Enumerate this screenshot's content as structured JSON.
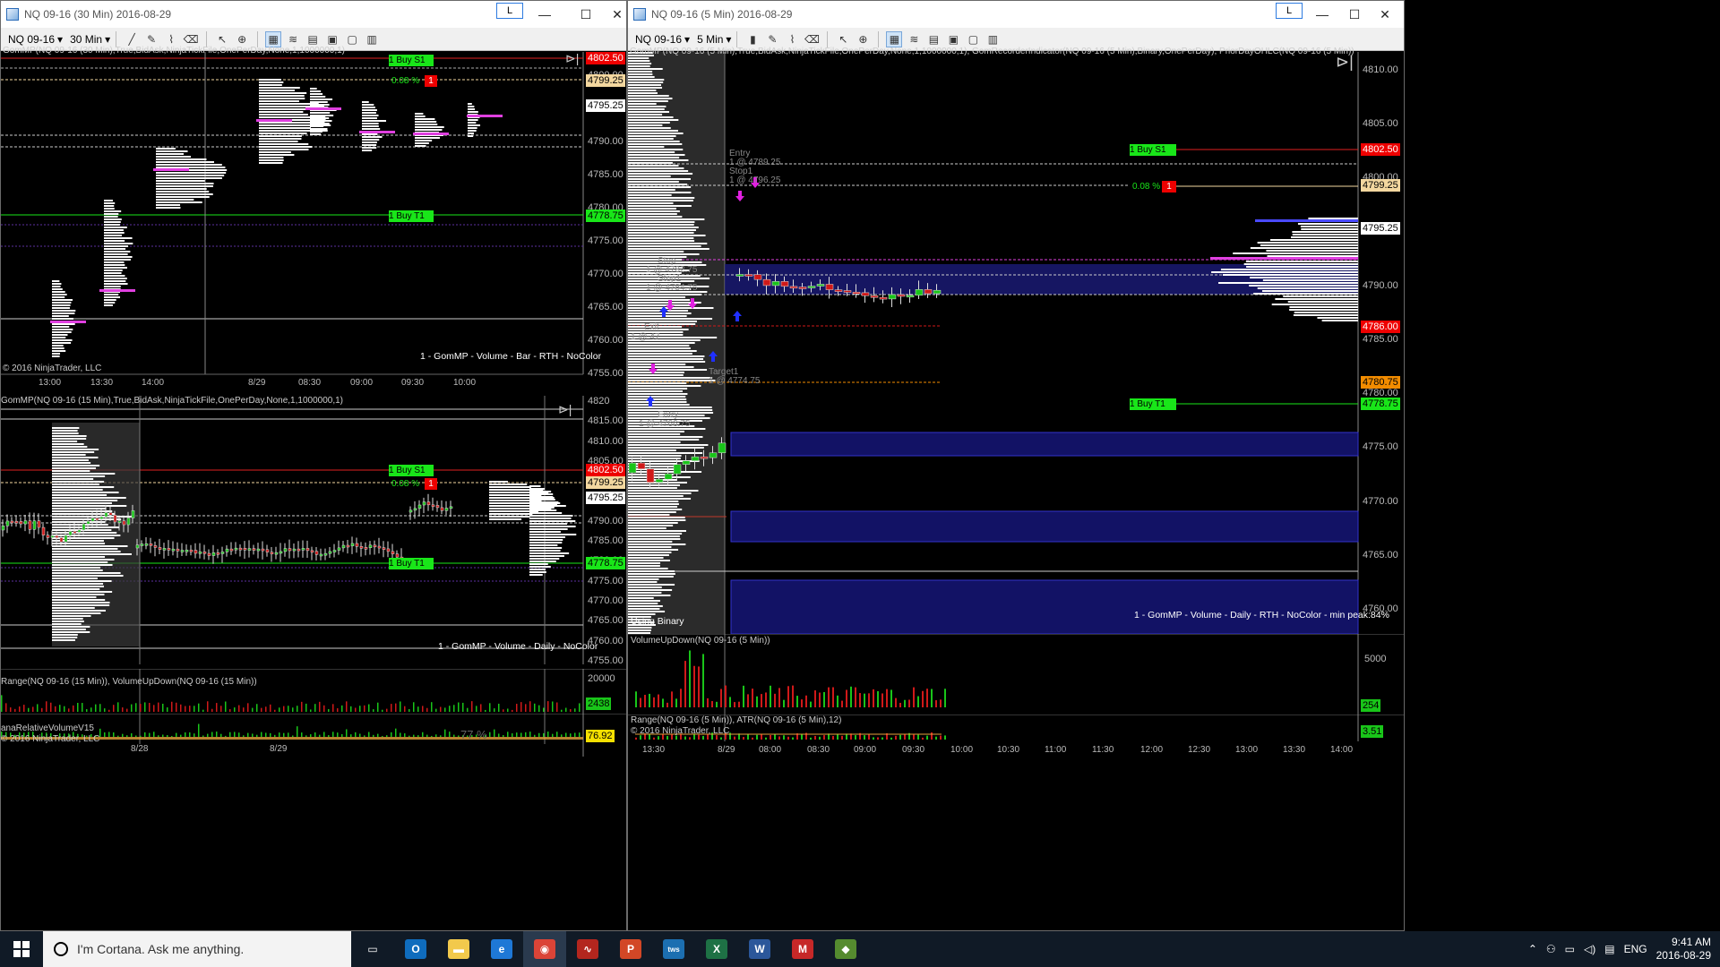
{
  "window_left": {
    "title": "NQ 09-16 (30 Min)  2016-08-29",
    "l_label": "L",
    "instrument": "NQ 09-16",
    "interval": "30 Min",
    "top_panel": {
      "indicator": "GomMP(NQ 09-16 (30 Min),True,BidAsk,NinjaTickFile,OnePerDay,None,1,1000000,1)",
      "copyright": "© 2016 NinjaTrader, LLC",
      "footer": "1 - GomMP  - Volume - Bar - RTH - NoColor",
      "price_ticks": [
        "4800.00",
        "4795.00",
        "4790.00",
        "4785.00",
        "4780.00",
        "4775.00",
        "4770.00",
        "4765.00",
        "4760.00",
        "4755.00"
      ],
      "time_ticks": [
        "13:00",
        "13:30",
        "14:00",
        "8/29",
        "08:30",
        "09:00",
        "09:30",
        "10:00"
      ],
      "tag_stop": "4802.50",
      "tag_pdc": "4799.25",
      "tag_last": "4795.25",
      "tag_target": "4778.75",
      "buy_s1": "1   Buy S1",
      "buy_t1": "1   Buy T1",
      "pct": "0.08 %",
      "pct_qty": "1"
    },
    "mid_panel": {
      "indicator": "GomMP(NQ 09-16 (15 Min),True,BidAsk,NinjaTickFile,OnePerDay,None,1,1000000,1)",
      "footer": "1 - GomMP  - Volume - Daily - NoColor",
      "price_ticks": [
        "4820",
        "4815.00",
        "4810.00",
        "4805.00",
        "4800.00",
        "4795.00",
        "4790.00",
        "4785.00",
        "4780.00",
        "4775.00",
        "4770.00",
        "4765.00",
        "4760.00",
        "4755.00"
      ],
      "tag_stop": "4802.50",
      "tag_pdc": "4799.25",
      "tag_last": "4795.25",
      "tag_target": "4778.75",
      "buy_s1": "1   Buy S1",
      "buy_t1": "1   Buy T1",
      "pct": "0.08 %",
      "pct_qty": "1"
    },
    "range_panel": {
      "indicator": "Range(NQ 09-16 (15 Min)), VolumeUpDown(NQ 09-16 (15 Min))",
      "tick": "20000",
      "tag": "2438"
    },
    "rel_panel": {
      "indicator": "anaRelativeVolumeV15",
      "copyright": "© 2016 NinjaTrader, LLC",
      "percent": "77 %",
      "tag": "76.92",
      "time_ticks": [
        "8/28",
        "8/29"
      ]
    }
  },
  "window_right": {
    "title": "NQ 09-16 (5 Min)  2016-08-29",
    "l_label": "L",
    "instrument": "NQ 09-16",
    "interval": "5 Min",
    "main_panel": {
      "indicator": "GomMP(NQ 09-16 (5 Min),True,BidAsk,NinjaTickFile,OnePerDay,None,1,1000000,1), GomRecorderIndicator(NQ 09-16 (5 Min),Binary,OnePerDay), PriorDayOHLC(NQ 09-16 (5 Min))",
      "using_binary": "Using Binary",
      "footer": "1 - GomMP  - Volume - Daily - RTH - NoColor - min peak:84%",
      "price_ticks": [
        "4810.00",
        "4805.00",
        "4800.00",
        "4795.00",
        "4790.00",
        "4785.00",
        "4780.00",
        "4775.00",
        "4770.00",
        "4765.00",
        "4760.00"
      ],
      "tag_stop": "4802.50",
      "tag_pdc": "4799.25",
      "tag_last": "4795.25",
      "tag_low": "4786.00",
      "tag_r1": "4780.75",
      "tag_target": "4778.75",
      "buy_s1": "1   Buy S1",
      "buy_t1": "1   Buy T1",
      "pct": "0.08 %",
      "pct_qty": "1",
      "trade_labels": [
        {
          "t": "Entry"
        },
        {
          "t": "1 @ 4789.25"
        },
        {
          "t": "Stop1"
        },
        {
          "t": "1 @ 4796.25"
        },
        {
          "t": "Stop"
        },
        {
          "t": "1 @ 4782.75"
        },
        {
          "t": "Stop1"
        },
        {
          "t": "1 @ 4784.75"
        },
        {
          "t": "Exit"
        },
        {
          "t": "1 @ 47"
        },
        {
          "t": "Target1"
        },
        {
          "t": "1 @ 4774.75"
        },
        {
          "t": "Entry"
        },
        {
          "t": "1 @ 4766.75"
        }
      ]
    },
    "volume_panel": {
      "indicator": "VolumeUpDown(NQ 09-16 (5 Min))",
      "tick": "5000",
      "tag": "254"
    },
    "range_panel": {
      "indicator": "Range(NQ 09-16 (5 Min)), ATR(NQ 09-16 (5 Min),12)",
      "copyright": "© 2016 NinjaTrader, LLC",
      "tag": "3.51",
      "time_ticks": [
        "13:30",
        "8/29",
        "08:00",
        "08:30",
        "09:00",
        "09:30",
        "10:00",
        "10:30",
        "11:00",
        "11:30",
        "12:00",
        "12:30",
        "13:00",
        "13:30",
        "14:00"
      ]
    }
  },
  "taskbar": {
    "search_placeholder": "I'm Cortana. Ask me anything.",
    "apps": [
      {
        "icon": "task-view-icon",
        "color": "#101a26",
        "glyph": "▭"
      },
      {
        "icon": "outlook-icon",
        "color": "#0f6cbd",
        "glyph": "O"
      },
      {
        "icon": "file-explorer-icon",
        "color": "#f2c94c",
        "glyph": "▬"
      },
      {
        "icon": "edge-icon",
        "color": "#1e78d6",
        "glyph": "e"
      },
      {
        "icon": "chrome-icon",
        "color": "#db4437",
        "glyph": "◉"
      },
      {
        "icon": "ninjatrader-icon",
        "color": "#b3261e",
        "glyph": "∿"
      },
      {
        "icon": "powerpoint-icon",
        "color": "#d24726",
        "glyph": "P"
      },
      {
        "icon": "tws-icon",
        "color": "#1c6fb1",
        "glyph": "tws"
      },
      {
        "icon": "excel-icon",
        "color": "#1e7145",
        "glyph": "X"
      },
      {
        "icon": "word-icon",
        "color": "#2b579a",
        "glyph": "W"
      },
      {
        "icon": "app-red-icon",
        "color": "#c62828",
        "glyph": "M"
      },
      {
        "icon": "app-green-icon",
        "color": "#558b2f",
        "glyph": "◆"
      }
    ],
    "language": "ENG",
    "time": "9:41 AM",
    "date": "2016-08-29"
  }
}
